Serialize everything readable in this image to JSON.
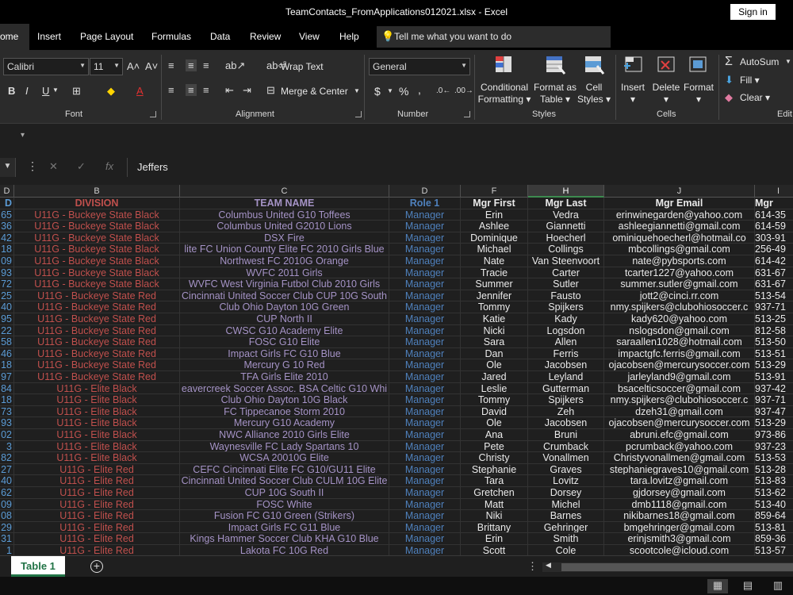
{
  "window": {
    "title": "TeamContacts_FromApplications012021.xlsx  -  Excel",
    "sign_in": "Sign in"
  },
  "tabs": [
    "ome",
    "Insert",
    "Page Layout",
    "Formulas",
    "Data",
    "Review",
    "View",
    "Help"
  ],
  "tell_me": "Tell me what you want to do",
  "ribbon": {
    "font_name": "Calibri",
    "font_size": "11",
    "wrap_text": "Wrap Text",
    "merge_center": "Merge & Center",
    "number_format": "General",
    "currency": "$",
    "percent": "%",
    "comma": ",",
    "groups": {
      "font": "Font",
      "alignment": "Alignment",
      "number": "Number",
      "styles": "Styles",
      "cells": "Cells",
      "editing": "Edit"
    },
    "conditional_formatting": [
      "Conditional",
      "Formatting"
    ],
    "format_as_table": [
      "Format as",
      "Table"
    ],
    "cell_styles": [
      "Cell",
      "Styles"
    ],
    "insert": "Insert",
    "delete": "Delete",
    "format": "Format",
    "autosum": "AutoSum",
    "fill": "Fill",
    "clear": "Clear"
  },
  "formula_bar": {
    "content": "Jeffers"
  },
  "columns": [
    "D",
    "B",
    "C",
    "D",
    "F",
    "H",
    "J",
    "I"
  ],
  "selected_column": "H",
  "header_row": {
    "id": "D",
    "division": "DIVISION",
    "team": "TEAM  NAME",
    "role": "Role 1",
    "first": "Mgr First",
    "last": "Mgr Last",
    "email": "Mgr Email",
    "phone": "Mgr"
  },
  "rows": [
    [
      "65",
      "U11G - Buckeye State Black",
      "Columbus United G10 Toffees",
      "Manager",
      "Erin",
      "Vedra",
      "erinwinegarden@yahoo.com",
      "614-35"
    ],
    [
      "36",
      "U11G - Buckeye State Black",
      "Columbus United G2010 Lions",
      "Manager",
      "Ashlee",
      "Giannetti",
      "ashleegiannetti@gmail.com",
      "614-59"
    ],
    [
      "42",
      "U11G - Buckeye State Black",
      "DSX Fire",
      "Manager",
      "Dominique",
      "Hoecherl",
      "ominiquehoecherl@hotmail.co",
      "303-91"
    ],
    [
      "18",
      "U11G - Buckeye State Black",
      "lite FC Union County Elite FC 2010 Girls Blue",
      "Manager",
      "Michael",
      "Collings",
      "mbcollings@gmail.com",
      "256-49"
    ],
    [
      "09",
      "U11G - Buckeye State Black",
      "Northwest FC 2010G Orange",
      "Manager",
      "Nate",
      "Van Steenvoort",
      "nate@pybsports.com",
      "614-42"
    ],
    [
      "93",
      "U11G - Buckeye State Black",
      "WVFC 2011 Girls",
      "Manager",
      "Tracie",
      "Carter",
      "tcarter1227@yahoo.com",
      "631-67"
    ],
    [
      "72",
      "U11G - Buckeye State Black",
      "WVFC West Virginia Futbol Club 2010 Girls",
      "Manager",
      "Summer",
      "Sutler",
      "summer.sutler@gmail.com",
      "631-67"
    ],
    [
      "25",
      "U11G - Buckeye State Red",
      "Cincinnati United Soccer Club CUP 10G South",
      "Manager",
      "Jennifer",
      "Fausto",
      "jott2@cinci.rr.com",
      "513-54"
    ],
    [
      "40",
      "U11G - Buckeye State Red",
      "Club Ohio Dayton 10G Green",
      "Manager",
      "Tommy",
      "Spijkers",
      "nmy.spijkers@clubohiosoccer.c",
      "937-71"
    ],
    [
      "95",
      "U11G - Buckeye State Red",
      "CUP North II",
      "Manager",
      "Katie",
      "Kady",
      "kady620@yahoo.com",
      "513-25"
    ],
    [
      "22",
      "U11G - Buckeye State Red",
      "CWSC G10 Academy Elite",
      "Manager",
      "Nicki",
      "Logsdon",
      "nslogsdon@gmail.com",
      "812-58"
    ],
    [
      "58",
      "U11G - Buckeye State Red",
      "FOSC G10 Elite",
      "Manager",
      "Sara",
      "Allen",
      "saraallen1028@hotmail.com",
      "513-50"
    ],
    [
      "46",
      "U11G - Buckeye State Red",
      "Impact Girls FC G10 Blue",
      "Manager",
      "Dan",
      "Ferris",
      "impactgfc.ferris@gmail.com",
      "513-51"
    ],
    [
      "18",
      "U11G - Buckeye State Red",
      "Mercury G 10 Red",
      "Manager",
      "Ole",
      "Jacobsen",
      "ojacobsen@mercurysoccer.com",
      "513-29"
    ],
    [
      "97",
      "U11G - Buckeye State Red",
      "TFA Girls Elite 2010",
      "Manager",
      "Jared",
      "Leyland",
      "jarleyland9@gmail.com",
      "513-91"
    ],
    [
      "84",
      "U11G - Elite Black",
      "eavercreek Soccer Assoc. BSA Celtic G10 Whi",
      "Manager",
      "Leslie",
      "Gutterman",
      "bsacelticsoccer@gmail.com",
      "937-42"
    ],
    [
      "18",
      "U11G - Elite Black",
      "Club Ohio Dayton 10G Black",
      "Manager",
      "Tommy",
      "Spijkers",
      "nmy.spijkers@clubohiosoccer.c",
      "937-71"
    ],
    [
      "73",
      "U11G - Elite Black",
      "FC Tippecanoe Storm 2010",
      "Manager",
      "David",
      "Zeh",
      "dzeh31@gmail.com",
      "937-47"
    ],
    [
      "93",
      "U11G - Elite Black",
      "Mercury G10 Academy",
      "Manager",
      "Ole",
      "Jacobsen",
      "ojacobsen@mercurysoccer.com",
      "513-29"
    ],
    [
      "02",
      "U11G - Elite Black",
      "NWC Alliance 2010 Girls Elite",
      "Manager",
      "Ana",
      "Bruni",
      "abruni.efc@gmail.com",
      "973-86"
    ],
    [
      "3",
      "U11G - Elite Black",
      "Waynesville FC Lady Spartans 10",
      "Manager",
      "Pete",
      "Crumback",
      "pcrumback@yahoo.com",
      "937-23"
    ],
    [
      "82",
      "U11G - Elite Black",
      "WCSA 20010G Elite",
      "Manager",
      "Christy",
      "Vonallmen",
      "Christyvonallmen@gmail.com",
      "513-53"
    ],
    [
      "27",
      "U11G - Elite Red",
      "CEFC Cincinnati Elite FC G10/GU11 Elite",
      "Manager",
      "Stephanie",
      "Graves",
      "stephaniegraves10@gmail.com",
      "513-28"
    ],
    [
      "40",
      "U11G - Elite Red",
      "Cincinnati United Soccer Club CULM 10G Elite",
      "Manager",
      "Tara",
      "Lovitz",
      "tara.lovitz@gmail.com",
      "513-83"
    ],
    [
      "62",
      "U11G - Elite Red",
      "CUP 10G South II",
      "Manager",
      "Gretchen",
      "Dorsey",
      "gjdorsey@gmail.com",
      "513-62"
    ],
    [
      "09",
      "U11G - Elite Red",
      "FOSC White",
      "Manager",
      "Matt",
      "Michel",
      "dmb1118@gmail.com",
      "513-40"
    ],
    [
      "08",
      "U11G - Elite Red",
      "Fusion FC G10 Green (Strikers)",
      "Manager",
      "Niki",
      "Barnes",
      "nikibarnes18@gmail.com",
      "859-64"
    ],
    [
      "29",
      "U11G - Elite Red",
      "Impact Girls FC G11 Blue",
      "Manager",
      "Brittany",
      "Gehringer",
      "bmgehringer@gmail.com",
      "513-81"
    ],
    [
      "31",
      "U11G - Elite Red",
      "Kings Hammer Soccer Club KHA G10 Blue",
      "Manager",
      "Erin",
      "Smith",
      "erinjsmith3@gmail.com",
      "859-36"
    ],
    [
      "1",
      "U11G - Elite Red",
      "Lakota FC 10G Red",
      "Manager",
      "Scott",
      "Cole",
      "scootcole@icloud.com",
      "513-57"
    ]
  ],
  "sheet_tab": "Table 1",
  "colors": {
    "division": "#c0504d",
    "team": "#a593c6",
    "role": "#4f81bd",
    "accent": "#217346"
  }
}
